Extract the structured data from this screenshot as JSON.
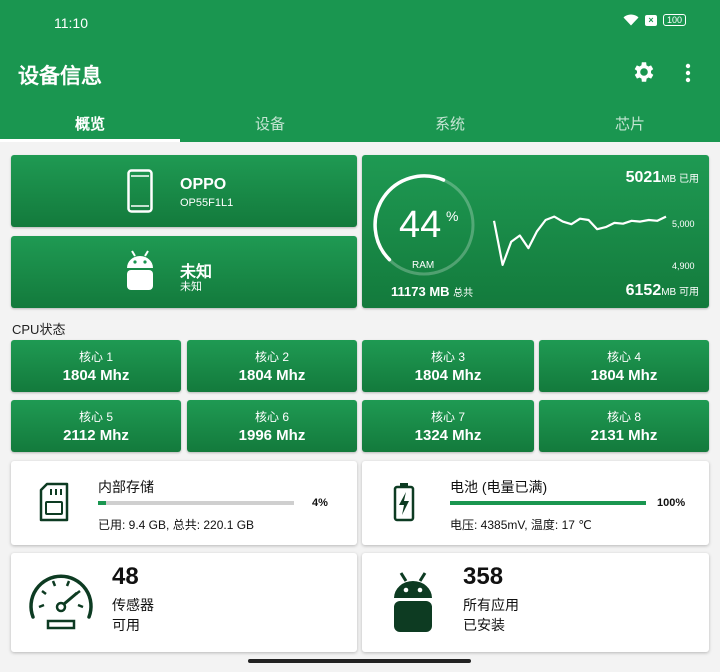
{
  "status_bar": {
    "time": "11:10",
    "battery": "100"
  },
  "header": {
    "title": "设备信息",
    "settings_icon": "gear-icon",
    "more_icon": "more-vert-icon"
  },
  "tabs": [
    {
      "label": "概览",
      "active": true
    },
    {
      "label": "设备",
      "active": false
    },
    {
      "label": "系统",
      "active": false
    },
    {
      "label": "芯片",
      "active": false
    }
  ],
  "device": {
    "brand": "OPPO",
    "model": "OP55F1L1",
    "icon": "phone-icon"
  },
  "os": {
    "name": "未知",
    "detail": "未知",
    "icon": "android-icon"
  },
  "ram": {
    "percent": 44,
    "percent_text": "44",
    "percent_sign": "%",
    "label": "RAM",
    "used_value": "5021",
    "used_unit": "MB 已用",
    "total_value": "11173 MB",
    "total_unit": "总共",
    "free_value": "6152",
    "free_unit": "MB 可用",
    "axis_ticks": [
      "5,000",
      "4,900"
    ],
    "history": [
      5010,
      4905,
      4960,
      4975,
      4945,
      4985,
      5012,
      5020,
      5008,
      5002,
      5015,
      5012,
      4990,
      4995,
      5005,
      5003,
      5010,
      5008,
      5012,
      5010,
      5020
    ]
  },
  "cpu": {
    "section_label": "CPU状态",
    "cores": [
      {
        "name": "核心 1",
        "freq": "1804 Mhz"
      },
      {
        "name": "核心 2",
        "freq": "1804 Mhz"
      },
      {
        "name": "核心 3",
        "freq": "1804 Mhz"
      },
      {
        "name": "核心 4",
        "freq": "1804 Mhz"
      },
      {
        "name": "核心 5",
        "freq": "2112 Mhz"
      },
      {
        "name": "核心 6",
        "freq": "1996 Mhz"
      },
      {
        "name": "核心 7",
        "freq": "1324 Mhz"
      },
      {
        "name": "核心 8",
        "freq": "2131 Mhz"
      }
    ]
  },
  "storage": {
    "title": "内部存储",
    "percent": 4,
    "percent_text": "4%",
    "detail": "已用: 9.4 GB,  总共: 220.1 GB",
    "icon": "sd-card-icon"
  },
  "battery": {
    "title": "电池 (电量已满)",
    "percent": 100,
    "percent_text": "100%",
    "detail": "电压: 4385mV,  温度: 17 ℃",
    "icon": "battery-charging-icon"
  },
  "sensors": {
    "count": "48",
    "line1": "传感器",
    "line2": "可用",
    "icon": "speedometer-icon"
  },
  "apps": {
    "count": "358",
    "line1": "所有应用",
    "line2": "已安装",
    "icon": "android-icon"
  },
  "colors": {
    "primary": "#1a9650",
    "card_dark": "#137a3c",
    "background": "#f3f3f3"
  }
}
